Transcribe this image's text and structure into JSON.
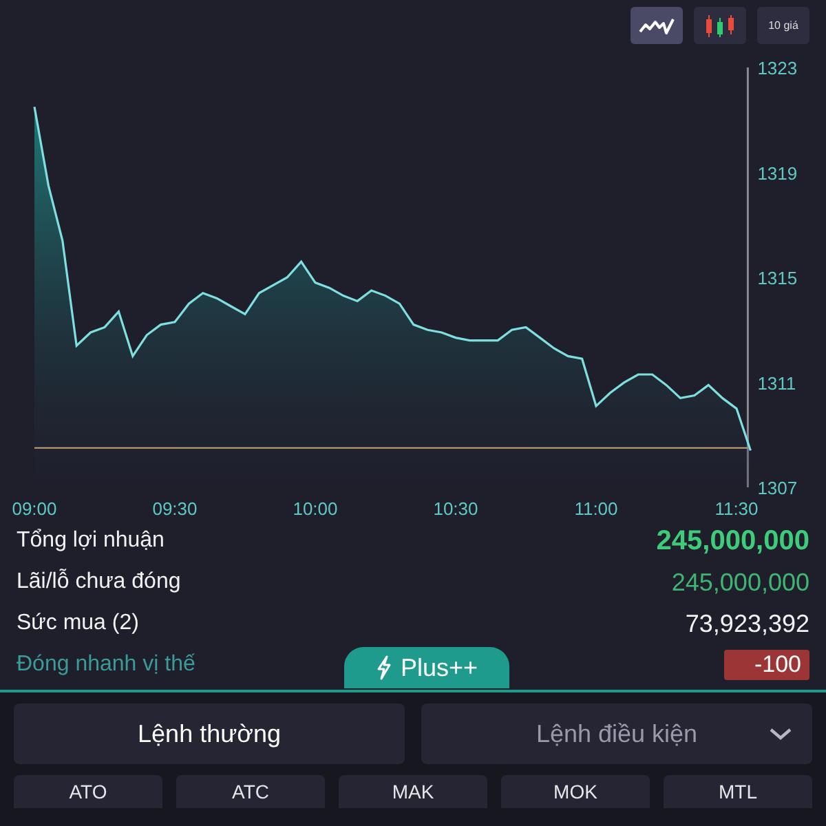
{
  "chart_toolbar": [
    {
      "kind": "line",
      "selected": true
    },
    {
      "kind": "candles",
      "selected": false
    },
    {
      "kind": "text",
      "label": "10 giá",
      "selected": false
    }
  ],
  "chart": {
    "chart_data": {
      "type": "area",
      "categories": [
        "09:00",
        null,
        null,
        null,
        null,
        null,
        null,
        null,
        null,
        null,
        "09:30",
        null,
        null,
        null,
        null,
        null,
        null,
        null,
        null,
        null,
        "10:00",
        null,
        null,
        null,
        null,
        null,
        null,
        null,
        null,
        null,
        "10:30",
        null,
        null,
        null,
        null,
        null,
        null,
        null,
        null,
        null,
        "11:00",
        null,
        null,
        null,
        null,
        null,
        null,
        null,
        null,
        null,
        "11:30",
        null
      ],
      "series": [
        {
          "color": "#7fdfe0",
          "values": [
            1321.5,
            1318.5,
            1316.4,
            1312.4,
            1312.9,
            1313.1,
            1313.7,
            1312.0,
            1312.8,
            1313.2,
            1313.3,
            1314.0,
            1314.4,
            1314.2,
            1313.9,
            1313.6,
            1314.4,
            1314.7,
            1315.0,
            1315.6,
            1314.8,
            1314.6,
            1314.3,
            1314.1,
            1314.5,
            1314.3,
            1314.0,
            1313.2,
            1313.0,
            1312.9,
            1312.7,
            1312.6,
            1312.6,
            1312.6,
            1313.0,
            1313.1,
            1312.7,
            1312.3,
            1312.0,
            1311.9,
            1310.1,
            1310.6,
            1311.0,
            1311.3,
            1311.3,
            1310.9,
            1310.4,
            1310.5,
            1310.9,
            1310.4,
            1310.0,
            1308.4
          ]
        }
      ],
      "ylim": [
        1307,
        1323
      ],
      "yticks": [
        1307,
        1311,
        1315,
        1319,
        1323
      ],
      "ref_lines": [
        {
          "axis": "y",
          "value": 1308.5,
          "color": "#c9a27a"
        }
      ]
    }
  },
  "summary": [
    {
      "label": "Tổng lợi nhuận",
      "value": "245,000,000",
      "kind": "total"
    },
    {
      "label": "Lãi/lỗ chưa đóng",
      "value": "245,000,000",
      "kind": "profit"
    },
    {
      "label": "Sức mua (2)",
      "value": "73,923,392",
      "kind": "plain"
    }
  ],
  "quick_close": {
    "label": "Đóng nhanh vị thế",
    "value": "-100"
  },
  "plus_tab": {
    "label": "Plus++"
  },
  "order_tabs": [
    {
      "label": "Lệnh thường",
      "selected": true,
      "dropdown": false
    },
    {
      "label": "Lệnh điều kiện",
      "selected": false,
      "dropdown": true
    }
  ],
  "order_types": [
    "ATO",
    "ATC",
    "MAK",
    "MOK",
    "MTL"
  ]
}
